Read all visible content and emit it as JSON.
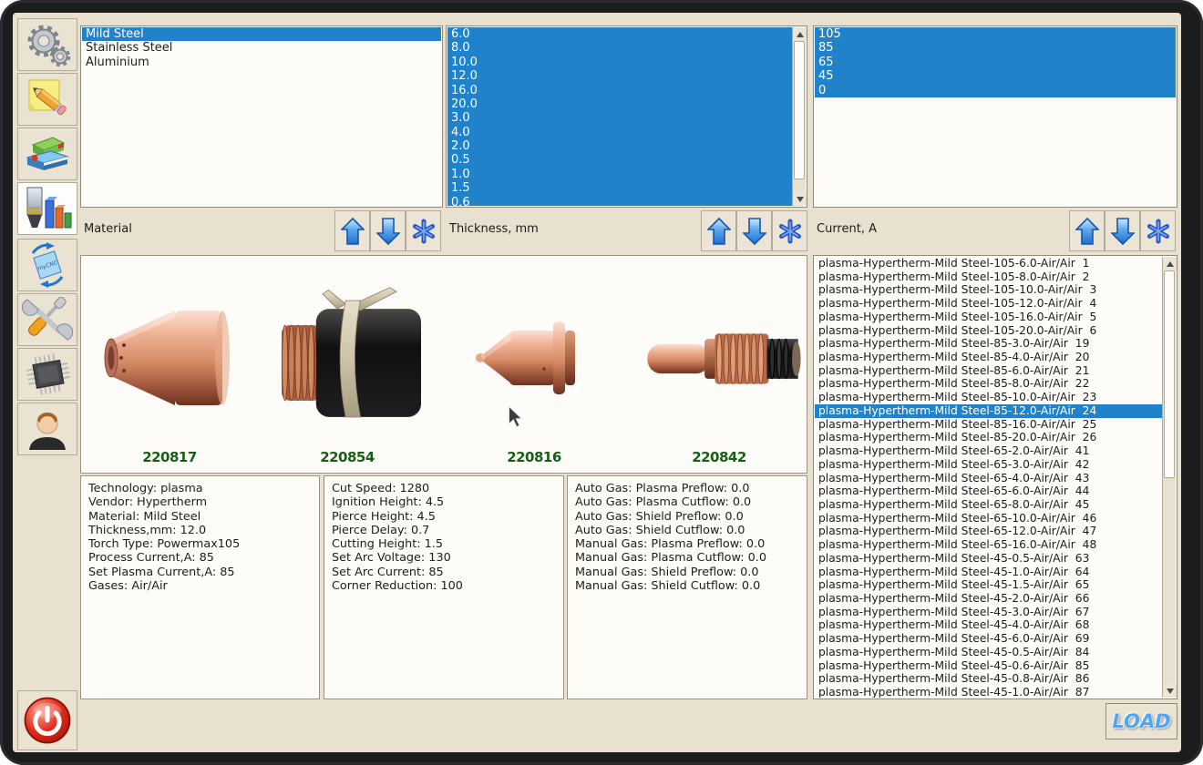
{
  "sidebar": {
    "mycnc_icon_text": "myCNC",
    "items": [
      {
        "id": "settings",
        "icon": "gears-icon"
      },
      {
        "id": "edit-note",
        "icon": "note-pencil-icon"
      },
      {
        "id": "library",
        "icon": "books-icon"
      },
      {
        "id": "cutcharts",
        "icon": "torch-chart-icon",
        "selected": true
      },
      {
        "id": "rotate-mycnc",
        "icon": "mycnc-rotate-icon"
      },
      {
        "id": "tools",
        "icon": "tools-icon"
      },
      {
        "id": "hardware",
        "icon": "chip-icon"
      },
      {
        "id": "user",
        "icon": "user-icon"
      }
    ],
    "power": {
      "icon": "power-icon"
    }
  },
  "selectors": {
    "material": {
      "label": "Material",
      "items": [
        "Mild Steel",
        "Stainless Steel",
        "Aluminium"
      ],
      "selected_indices": [
        0
      ]
    },
    "thickness": {
      "label": "Thickness, mm",
      "items": [
        "6.0",
        "8.0",
        "10.0",
        "12.0",
        "16.0",
        "20.0",
        "3.0",
        "4.0",
        "2.0",
        "0.5",
        "1.0",
        "1.5",
        "0.6"
      ],
      "selected_indices": "all"
    },
    "current": {
      "label": "Current, A",
      "items": [
        "105",
        "85",
        "65",
        "45",
        "0"
      ],
      "selected_indices": "all"
    }
  },
  "consumables": {
    "part_numbers": [
      "220817",
      "220854",
      "220816",
      "220842"
    ],
    "part_names": [
      "shield",
      "retaining-cap",
      "nozzle",
      "electrode"
    ]
  },
  "info_panels": {
    "technology": [
      "Technology: plasma",
      "Vendor: Hypertherm",
      "Material: Mild Steel",
      "Thickness,mm: 12.0",
      "Torch Type: Powermax105",
      "Process Current,A: 85",
      "Set Plasma Current,A: 85",
      "Gases: Air/Air"
    ],
    "cutting": [
      "Cut Speed: 1280",
      "Ignition Height: 4.5",
      "Pierce Height: 4.5",
      "Pierce Delay: 0.7",
      "Cutting Height: 1.5",
      "Set Arc Voltage: 130",
      "Set Arc Current: 85",
      "Corner Reduction: 100"
    ],
    "gas": [
      "Auto Gas: Plasma Preflow: 0.0",
      "Auto Gas: Plasma Cutflow: 0.0",
      "Auto Gas: Shield Preflow: 0.0",
      "Auto Gas: Shield Cutflow: 0.0",
      "Manual Gas: Plasma Preflow: 0.0",
      "Manual Gas: Plasma Cutflow: 0.0",
      "Manual Gas: Shield Preflow: 0.0",
      "Manual Gas: Shield Cutflow: 0.0"
    ]
  },
  "cutchart_list": {
    "selected_index": 11,
    "items": [
      "plasma-Hypertherm-Mild Steel-105-6.0-Air/Air  1",
      "plasma-Hypertherm-Mild Steel-105-8.0-Air/Air  2",
      "plasma-Hypertherm-Mild Steel-105-10.0-Air/Air  3",
      "plasma-Hypertherm-Mild Steel-105-12.0-Air/Air  4",
      "plasma-Hypertherm-Mild Steel-105-16.0-Air/Air  5",
      "plasma-Hypertherm-Mild Steel-105-20.0-Air/Air  6",
      "plasma-Hypertherm-Mild Steel-85-3.0-Air/Air  19",
      "plasma-Hypertherm-Mild Steel-85-4.0-Air/Air  20",
      "plasma-Hypertherm-Mild Steel-85-6.0-Air/Air  21",
      "plasma-Hypertherm-Mild Steel-85-8.0-Air/Air  22",
      "plasma-Hypertherm-Mild Steel-85-10.0-Air/Air  23",
      "plasma-Hypertherm-Mild Steel-85-12.0-Air/Air  24",
      "plasma-Hypertherm-Mild Steel-85-16.0-Air/Air  25",
      "plasma-Hypertherm-Mild Steel-85-20.0-Air/Air  26",
      "plasma-Hypertherm-Mild Steel-65-2.0-Air/Air  41",
      "plasma-Hypertherm-Mild Steel-65-3.0-Air/Air  42",
      "plasma-Hypertherm-Mild Steel-65-4.0-Air/Air  43",
      "plasma-Hypertherm-Mild Steel-65-6.0-Air/Air  44",
      "plasma-Hypertherm-Mild Steel-65-8.0-Air/Air  45",
      "plasma-Hypertherm-Mild Steel-65-10.0-Air/Air  46",
      "plasma-Hypertherm-Mild Steel-65-12.0-Air/Air  47",
      "plasma-Hypertherm-Mild Steel-65-16.0-Air/Air  48",
      "plasma-Hypertherm-Mild Steel-45-0.5-Air/Air  63",
      "plasma-Hypertherm-Mild Steel-45-1.0-Air/Air  64",
      "plasma-Hypertherm-Mild Steel-45-1.5-Air/Air  65",
      "plasma-Hypertherm-Mild Steel-45-2.0-Air/Air  66",
      "plasma-Hypertherm-Mild Steel-45-3.0-Air/Air  67",
      "plasma-Hypertherm-Mild Steel-45-4.0-Air/Air  68",
      "plasma-Hypertherm-Mild Steel-45-6.0-Air/Air  69",
      "plasma-Hypertherm-Mild Steel-45-0.5-Air/Air  84",
      "plasma-Hypertherm-Mild Steel-45-0.6-Air/Air  85",
      "plasma-Hypertherm-Mild Steel-45-0.8-Air/Air  86",
      "plasma-Hypertherm-Mild Steel-45-1.0-Air/Air  87"
    ]
  },
  "actions": {
    "load_label": "LOAD"
  },
  "colors": {
    "background": "#e9e1cf",
    "selection_blue": "#1f82cb",
    "part_number_green": "#175e17",
    "load_blue": "#55a5ea",
    "power_red": "#d92c1a"
  }
}
